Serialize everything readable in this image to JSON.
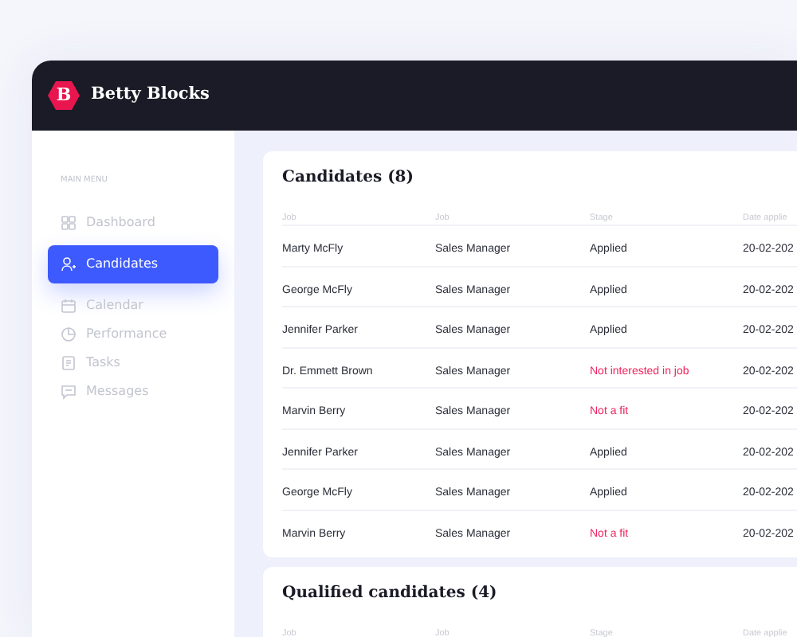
{
  "brand": {
    "logo_letter": "B",
    "name": "Betty Blocks"
  },
  "sidebar": {
    "section": "MAIN MENU",
    "items": [
      {
        "label": "Dashboard",
        "selected": false
      },
      {
        "label": "Candidates",
        "selected": true
      },
      {
        "label": "Calendar",
        "selected": false
      },
      {
        "label": "Performance",
        "selected": false
      },
      {
        "label": "Tasks",
        "selected": false
      },
      {
        "label": "Messages",
        "selected": false
      }
    ]
  },
  "cards": [
    {
      "title": "Candidates (8)",
      "columns": [
        "Job",
        "Job",
        "Stage",
        "Date applie"
      ],
      "rows": [
        {
          "cells": [
            "Marty McFly",
            "Sales Manager",
            "Applied",
            "20-02-202"
          ],
          "kind": "normal"
        },
        {
          "cells": [
            "George McFly",
            "Sales Manager",
            "Applied",
            "20-02-202"
          ],
          "kind": "normal"
        },
        {
          "cells": [
            "Jennifer Parker",
            "Sales Manager",
            "Applied",
            "20-02-202"
          ],
          "kind": "normal"
        },
        {
          "cells": [
            "Dr. Emmett Brown",
            "Sales Manager",
            "Not interested in job",
            "20-02-202"
          ],
          "kind": "rejected"
        },
        {
          "cells": [
            "Marvin Berry",
            "Sales Manager",
            "Not a fit",
            "20-02-202"
          ],
          "kind": "rejected"
        },
        {
          "cells": [
            "Jennifer Parker",
            "Sales Manager",
            "Applied",
            "20-02-202"
          ],
          "kind": "normal"
        },
        {
          "cells": [
            "George McFly",
            "Sales Manager",
            "Applied",
            "20-02-202"
          ],
          "kind": "normal"
        },
        {
          "cells": [
            "Marvin Berry",
            "Sales Manager",
            "Not a fit",
            "20-02-202"
          ],
          "kind": "rejected"
        }
      ]
    },
    {
      "title": "Qualified candidates (4)",
      "columns": [
        "Job",
        "Job",
        "Stage",
        "Date applie"
      ]
    }
  ]
}
